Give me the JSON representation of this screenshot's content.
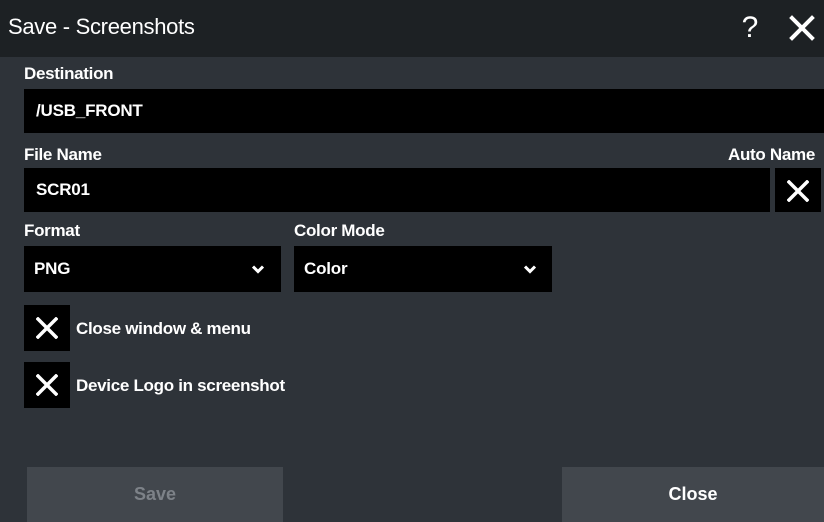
{
  "dialog": {
    "title": "Save - Screenshots",
    "help_label": "?"
  },
  "destination": {
    "label": "Destination",
    "value": "/USB_FRONT"
  },
  "file_name": {
    "label": "File Name",
    "value": "SCR01",
    "auto_name_label": "Auto Name",
    "auto_name_checked": true
  },
  "format": {
    "label": "Format",
    "selected": "PNG"
  },
  "color_mode": {
    "label": "Color Mode",
    "selected": "Color"
  },
  "options": [
    {
      "label": "Close window & menu",
      "checked": true
    },
    {
      "label": "Device Logo in screenshot",
      "checked": true
    }
  ],
  "buttons": {
    "save": "Save",
    "close": "Close"
  },
  "colors": {
    "background": "#2e3339",
    "titlebar": "#1d2124",
    "field": "#000000",
    "button": "#42474d",
    "disabled_text": "#7d8288"
  }
}
